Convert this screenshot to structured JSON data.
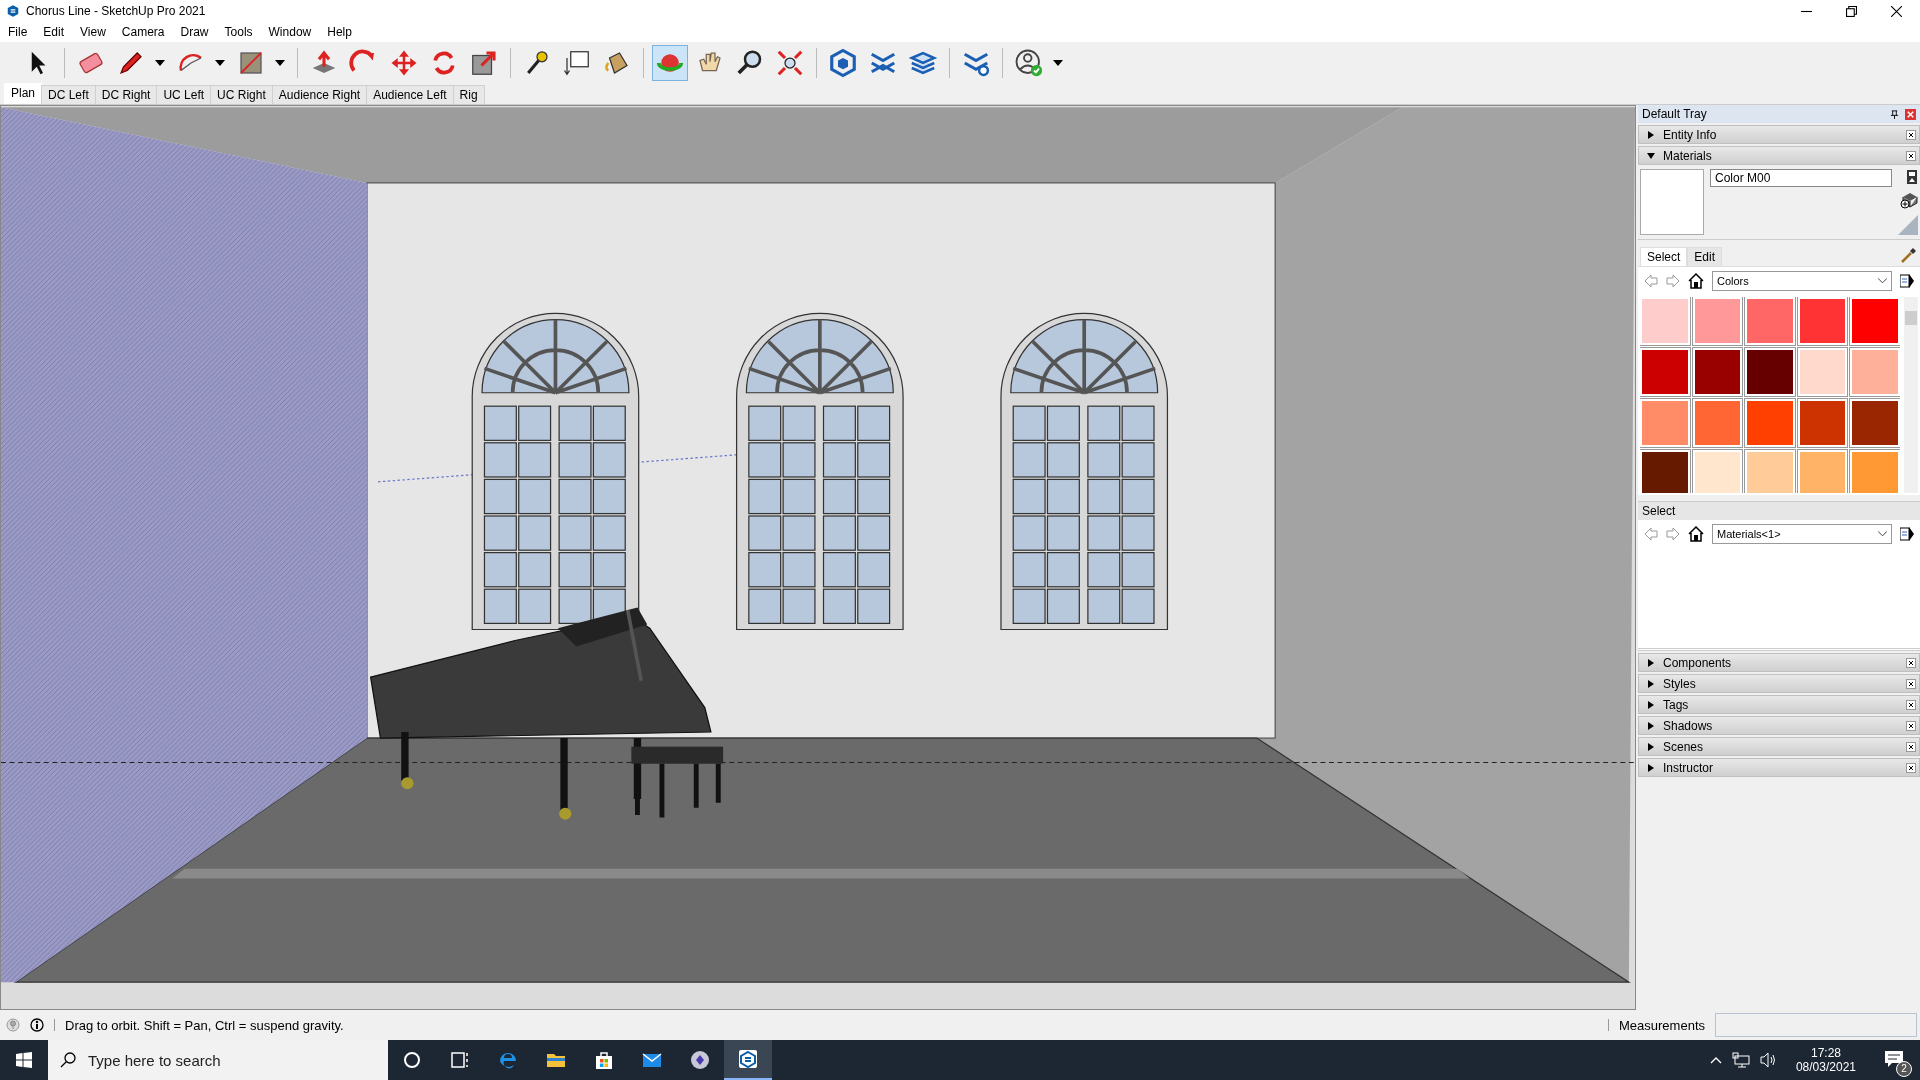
{
  "window": {
    "title": "Chorus Line - SketchUp Pro 2021"
  },
  "menu": [
    "File",
    "Edit",
    "View",
    "Camera",
    "Draw",
    "Tools",
    "Window",
    "Help"
  ],
  "toolbar": [
    {
      "tools": [
        {
          "kind": "select",
          "selected": false,
          "dropdown": false
        }
      ]
    },
    {
      "tools": [
        {
          "kind": "eraser",
          "selected": false,
          "dropdown": false
        },
        {
          "kind": "pencil",
          "selected": false,
          "dropdown": true
        },
        {
          "kind": "arc",
          "selected": false,
          "dropdown": true
        },
        {
          "kind": "rectangle",
          "selected": false,
          "dropdown": true
        }
      ]
    },
    {
      "tools": [
        {
          "kind": "pushpull",
          "selected": false,
          "dropdown": false
        },
        {
          "kind": "followme",
          "selected": false,
          "dropdown": false
        },
        {
          "kind": "move",
          "selected": false,
          "dropdown": false
        },
        {
          "kind": "rotate",
          "selected": false,
          "dropdown": false
        },
        {
          "kind": "scale",
          "selected": false,
          "dropdown": false
        }
      ]
    },
    {
      "tools": [
        {
          "kind": "tape",
          "selected": false,
          "dropdown": false
        },
        {
          "kind": "text",
          "selected": false,
          "dropdown": false
        },
        {
          "kind": "paint",
          "selected": false,
          "dropdown": false
        }
      ]
    },
    {
      "tools": [
        {
          "kind": "orbit",
          "selected": true,
          "dropdown": false
        },
        {
          "kind": "pan",
          "selected": false,
          "dropdown": false
        },
        {
          "kind": "zoom",
          "selected": false,
          "dropdown": false
        },
        {
          "kind": "zoomextents",
          "selected": false,
          "dropdown": false
        }
      ]
    },
    {
      "tools": [
        {
          "kind": "warehouse",
          "selected": false,
          "dropdown": false
        },
        {
          "kind": "extwarehouse",
          "selected": false,
          "dropdown": false
        },
        {
          "kind": "layout",
          "selected": false,
          "dropdown": false
        }
      ]
    },
    {
      "tools": [
        {
          "kind": "extmanager",
          "selected": false,
          "dropdown": false
        }
      ]
    },
    {
      "tools": [
        {
          "kind": "profile",
          "selected": false,
          "dropdown": true
        }
      ]
    }
  ],
  "scenes": [
    {
      "label": "Plan",
      "selected": true
    },
    {
      "label": "DC Left",
      "selected": false
    },
    {
      "label": "DC Right",
      "selected": false
    },
    {
      "label": "UC Left",
      "selected": false
    },
    {
      "label": "UC Right",
      "selected": false
    },
    {
      "label": "Audience Right",
      "selected": false
    },
    {
      "label": "Audience Left",
      "selected": false
    },
    {
      "label": "Rig",
      "selected": false
    }
  ],
  "tray": {
    "title": "Default Tray",
    "panels_top": [
      {
        "label": "Entity Info",
        "expanded": false
      },
      {
        "label": "Materials",
        "expanded": true
      }
    ],
    "materials": {
      "name": "Color M00",
      "tabs": [
        {
          "label": "Select",
          "selected": true
        },
        {
          "label": "Edit",
          "selected": false
        }
      ],
      "library": "Colors",
      "swatches": [
        {
          "color": "#ffcccc"
        },
        {
          "color": "#ff9999"
        },
        {
          "color": "#ff6666"
        },
        {
          "color": "#ff3333"
        },
        {
          "color": "#ff0000"
        },
        {
          "color": "#cc0000"
        },
        {
          "color": "#990000"
        },
        {
          "color": "#660000"
        },
        {
          "color": "#ffd9cc"
        },
        {
          "color": "#ffb09a"
        },
        {
          "color": "#ff8c66"
        },
        {
          "color": "#ff6633"
        },
        {
          "color": "#ff4000"
        },
        {
          "color": "#cc3300"
        },
        {
          "color": "#992600"
        },
        {
          "color": "#661a00"
        },
        {
          "color": "#ffe6cc"
        },
        {
          "color": "#ffcc99"
        },
        {
          "color": "#ffb366"
        },
        {
          "color": "#ff9933"
        }
      ],
      "secondary_label": "Select",
      "secondary_library": "Materials<1>"
    },
    "panels_bottom": [
      {
        "label": "Components",
        "expanded": false
      },
      {
        "label": "Styles",
        "expanded": false
      },
      {
        "label": "Tags",
        "expanded": false
      },
      {
        "label": "Shadows",
        "expanded": false
      },
      {
        "label": "Scenes",
        "expanded": false
      },
      {
        "label": "Instructor",
        "expanded": false
      }
    ]
  },
  "status_bar": {
    "hint": "Drag to orbit. Shift = Pan, Ctrl = suspend gravity.",
    "measurements_label": "Measurements"
  },
  "taskbar": {
    "search_placeholder": "Type here to search",
    "apps": [
      {
        "kind": "cortana",
        "selected": false
      },
      {
        "kind": "taskview",
        "selected": false
      },
      {
        "kind": "edge",
        "selected": false
      },
      {
        "kind": "explorer",
        "selected": false
      },
      {
        "kind": "store",
        "selected": false
      },
      {
        "kind": "mail",
        "selected": false
      },
      {
        "kind": "app",
        "selected": false
      },
      {
        "kind": "sketchup",
        "selected": true
      }
    ],
    "time": "17:28",
    "date": "08/03/2021",
    "notifications": "2"
  }
}
